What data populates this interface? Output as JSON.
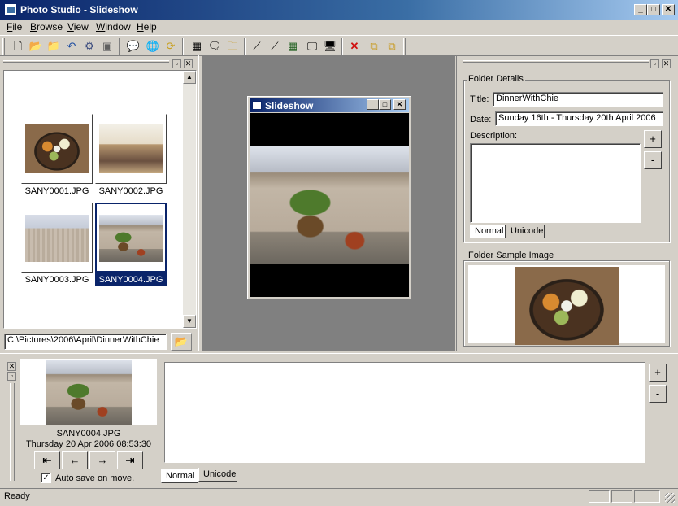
{
  "window": {
    "title": "Photo Studio - Slideshow"
  },
  "menu": [
    {
      "label": "File",
      "hot": "F",
      "rest": "ile"
    },
    {
      "label": "Browse",
      "hot": "B",
      "rest": "rowse"
    },
    {
      "label": "View",
      "hot": "V",
      "rest": "iew"
    },
    {
      "label": "Window",
      "hot": "W",
      "rest": "indow"
    },
    {
      "label": "Help",
      "hot": "H",
      "rest": "elp"
    }
  ],
  "toolbar": {
    "icons": [
      "new-document-icon",
      "open-folder-icon",
      "open-file-icon",
      "undo-icon",
      "settings-icon",
      "save-icon",
      "comment-icon",
      "globe-icon",
      "refresh-icon",
      "thumbnails-icon",
      "speech-icon",
      "folder-comment-icon",
      "magic-wand-icon",
      "xml-wand-icon",
      "grid-icon",
      "slideshow-icon",
      "monitor-icon",
      "delete-icon",
      "copy-icon",
      "paste-icon"
    ]
  },
  "browser": {
    "thumbnails": [
      {
        "name": "SANY0001.JPG",
        "kind": "food"
      },
      {
        "name": "SANY0002.JPG",
        "kind": "room"
      },
      {
        "name": "SANY0003.JPG",
        "kind": "balcony"
      },
      {
        "name": "SANY0004.JPG",
        "kind": "balcony2",
        "selected": true
      }
    ],
    "path": "C:\\Pictures\\2006\\April\\DinnerWithChie"
  },
  "slideshow": {
    "title": "Slideshow"
  },
  "folder_details": {
    "legend": "Folder Details",
    "title_label": "Title:",
    "title_value": "DinnerWithChie",
    "date_label": "Date:",
    "date_value": "Sunday 16th - Thursday 20th April 2006",
    "description_label": "Description:",
    "tabs": [
      "Normal",
      "Unicode"
    ],
    "plus": "+",
    "minus": "-"
  },
  "folder_sample": {
    "legend": "Folder Sample Image"
  },
  "preview": {
    "filename": "SANY0004.JPG",
    "datetime": "Thursday 20 Apr 2006 08:53:30",
    "autosave_label": "Auto save on move.",
    "autosave_checked": true,
    "nav": [
      "first-icon",
      "prev-icon",
      "next-icon",
      "last-icon"
    ]
  },
  "notes": {
    "tabs": [
      "Normal",
      "Unicode"
    ],
    "plus": "+",
    "minus": "-"
  },
  "status": {
    "text": "Ready"
  }
}
